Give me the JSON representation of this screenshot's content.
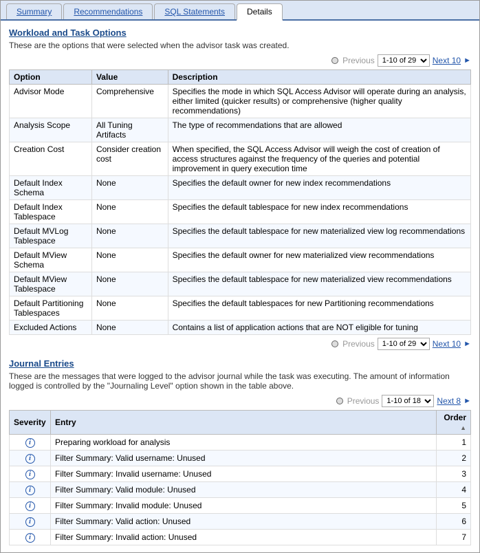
{
  "tabs": [
    {
      "label": "Summary",
      "active": false
    },
    {
      "label": "Recommendations",
      "active": false
    },
    {
      "label": "SQL Statements",
      "active": false
    },
    {
      "label": "Details",
      "active": true
    }
  ],
  "workload": {
    "title": "Workload and Task Options",
    "description": "These are the options that were selected when the advisor task was created.",
    "pagination": {
      "previous_label": "Previous",
      "page_value": "1-10 of 29",
      "next_label": "Next 10"
    },
    "pagination_bottom": {
      "previous_label": "Previous",
      "page_value": "1-10 of 29",
      "next_label": "Next 10"
    },
    "columns": [
      "Option",
      "Value",
      "Description"
    ],
    "rows": [
      {
        "option": "Advisor Mode",
        "value": "Comprehensive",
        "description": "Specifies the mode in which SQL Access Advisor will operate during an analysis, either limited (quicker results) or comprehensive (higher quality recommendations)"
      },
      {
        "option": "Analysis Scope",
        "value": "All Tuning Artifacts",
        "description": "The type of recommendations that are allowed"
      },
      {
        "option": "Creation Cost",
        "value": "Consider creation cost",
        "description": "When specified, the SQL Access Advisor will weigh the cost of creation of access structures against the frequency of the queries and potential improvement in query execution time"
      },
      {
        "option": "Default Index Schema",
        "value": "None",
        "description": "Specifies the default owner for new index recommendations"
      },
      {
        "option": "Default Index Tablespace",
        "value": "None",
        "description": "Specifies the default tablespace for new index recommendations"
      },
      {
        "option": "Default MVLog Tablespace",
        "value": "None",
        "description": "Specifies the default tablespace for new materialized view log recommendations"
      },
      {
        "option": "Default MView Schema",
        "value": "None",
        "description": "Specifies the default owner for new materialized view recommendations"
      },
      {
        "option": "Default MView Tablespace",
        "value": "None",
        "description": "Specifies the default tablespace for new materialized view recommendations"
      },
      {
        "option": "Default Partitioning Tablespaces",
        "value": "None",
        "description": "Specifies the default tablespaces for new Partitioning recommendations"
      },
      {
        "option": "Excluded Actions",
        "value": "None",
        "description": "Contains a list of application actions that are NOT eligible for tuning"
      }
    ]
  },
  "journal": {
    "title": "Journal Entries",
    "description": "These are the messages that were logged to the advisor journal while the task was executing. The amount of information logged is controlled by the \"Journaling Level\" option shown in the table above.",
    "pagination": {
      "previous_label": "Previous",
      "page_value": "1-10 of 18",
      "next_label": "Next 8"
    },
    "columns": [
      "Severity",
      "Entry",
      "Order"
    ],
    "rows": [
      {
        "severity": "i",
        "entry": "Preparing workload for analysis",
        "order": "1"
      },
      {
        "severity": "i",
        "entry": "Filter Summary: Valid username: Unused",
        "order": "2"
      },
      {
        "severity": "i",
        "entry": "Filter Summary: Invalid username: Unused",
        "order": "3"
      },
      {
        "severity": "i",
        "entry": "Filter Summary: Valid module: Unused",
        "order": "4"
      },
      {
        "severity": "i",
        "entry": "Filter Summary: Invalid module: Unused",
        "order": "5"
      },
      {
        "severity": "i",
        "entry": "Filter Summary: Valid action: Unused",
        "order": "6"
      },
      {
        "severity": "i",
        "entry": "Filter Summary: Invalid action: Unused",
        "order": "7"
      }
    ]
  }
}
